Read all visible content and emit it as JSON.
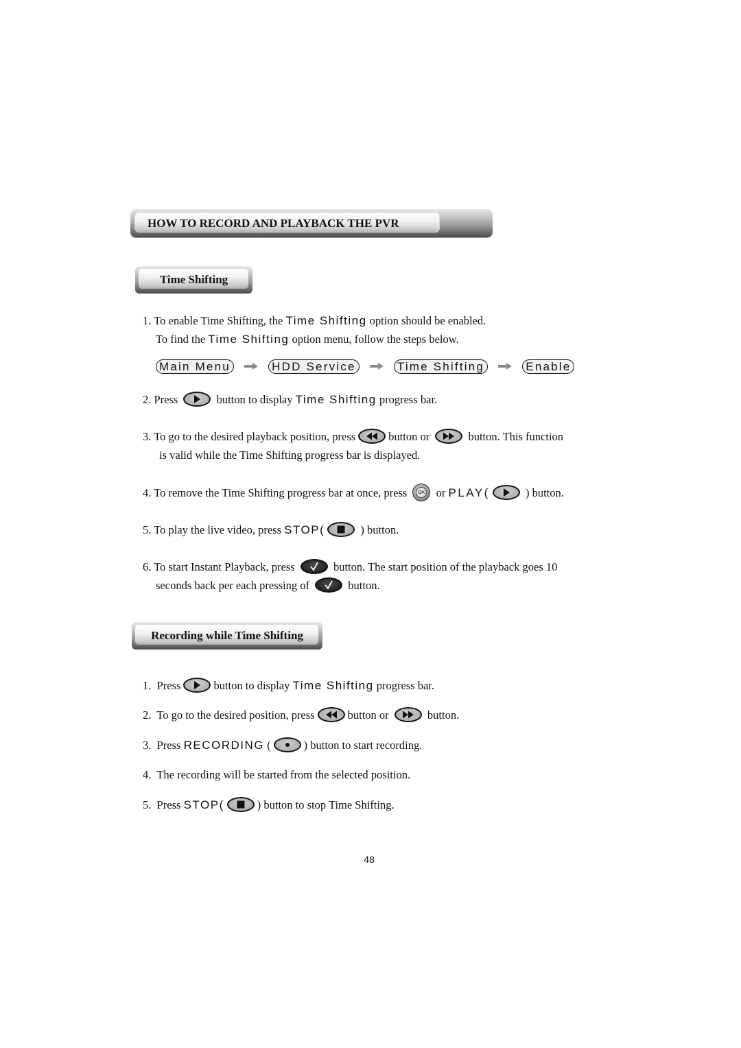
{
  "header": {
    "title": "HOW TO RECORD AND PLAYBACK THE PVR"
  },
  "time_shifting": {
    "heading": "Time Shifting",
    "steps": [
      {
        "num": "1.",
        "line1_pre": "To enable Time Shifting, the ",
        "line1_keyword": "Time Shifting",
        "line1_post": " option should be enabled.",
        "line2_pre": "To find the ",
        "line2_keyword": "Time Shifting",
        "line2_post": " option menu, follow the steps below."
      },
      {
        "num": "2.",
        "pre": "Press",
        "icon": "play-button",
        "mid": "button to display ",
        "keyword": "Time Shifting",
        "post": " progress bar."
      },
      {
        "num": "3.",
        "pre": "To go to the desired playback position, press",
        "icon1": "rewind-button",
        "mid": "button  or",
        "icon2": "fast-forward-button",
        "post": "button. This function",
        "line2": "is valid while the Time Shifting progress bar is displayed."
      },
      {
        "num": "4.",
        "pre": "To remove the Time Shifting progress bar at once, press",
        "icon1": "ok-button",
        "icon1_label": "OK",
        "mid": "or ",
        "keyword": "PLAY(",
        "icon2": "play-button",
        "post": ") button."
      },
      {
        "num": "5.",
        "pre": "To play the live video, press ",
        "keyword": "STOP(",
        "icon": "stop-button",
        "post": ") button."
      },
      {
        "num": "6.",
        "pre": "To start Instant Playback, press",
        "icon": "check-button",
        "post": "button. The start position of the playback goes 10",
        "line2_pre": "seconds back per each pressing of",
        "line2_post": "button."
      }
    ],
    "menu_path": [
      "Main Menu",
      "HDD Service",
      "Time Shifting",
      "Enable"
    ]
  },
  "recording_while": {
    "heading": "Recording while Time Shifting",
    "steps": [
      {
        "num": "1.",
        "pre": "Press",
        "icon": "play-button",
        "mid": "button to display ",
        "keyword": "Time Shifting",
        "post": " progress bar."
      },
      {
        "num": "2.",
        "pre": "To go to the desired position, press",
        "icon1": "rewind-button",
        "mid": "button  or",
        "icon2": "fast-forward-button",
        "post": "button."
      },
      {
        "num": "3.",
        "pre": "Press ",
        "keyword": "RECORDING",
        "open": " (",
        "icon": "record-button",
        "post": ") button to start recording."
      },
      {
        "num": "4.",
        "text": "The recording will be started from the selected position."
      },
      {
        "num": "5.",
        "pre": "Press ",
        "keyword": "STOP(",
        "icon": "stop-button",
        "post": ") button to stop Time Shifting."
      }
    ]
  },
  "footer": {
    "page_number": "48"
  },
  "colors": {
    "text": "#111111",
    "button_gray": "#b0b0b0",
    "button_dark": "#262626",
    "arrow_gray": "#8a8a8a"
  }
}
